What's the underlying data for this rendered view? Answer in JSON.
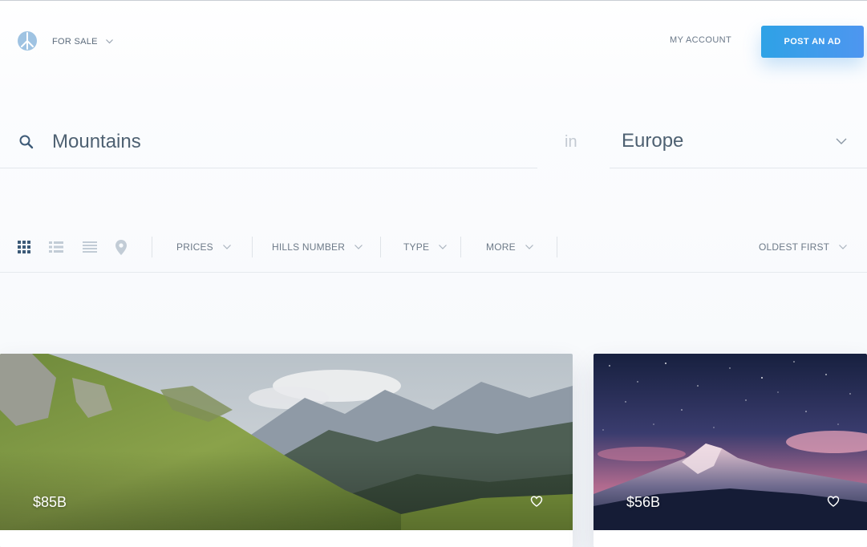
{
  "header": {
    "category_label": "FOR SALE",
    "my_account_label": "MY ACCOUNT",
    "post_ad_label": "POST AN AD"
  },
  "search": {
    "query": "Mountains",
    "connector": "in",
    "location": "Europe"
  },
  "filters": {
    "views": [
      "grid-view-icon",
      "list-view-icon",
      "compact-list-icon",
      "map-pin-icon"
    ],
    "items": [
      {
        "label": "PRICES"
      },
      {
        "label": "HILLS NUMBER"
      },
      {
        "label": "TYPE"
      },
      {
        "label": "MORE"
      }
    ],
    "sort_label": "OLDEST FIRST"
  },
  "listings": [
    {
      "price": "$85B",
      "icon": "heart-icon"
    },
    {
      "price": "$56B",
      "icon": "heart-icon"
    }
  ],
  "colors": {
    "accent_start": "#2ea2e6",
    "accent_end": "#4e96f0",
    "active_icon": "#3c5a78"
  }
}
